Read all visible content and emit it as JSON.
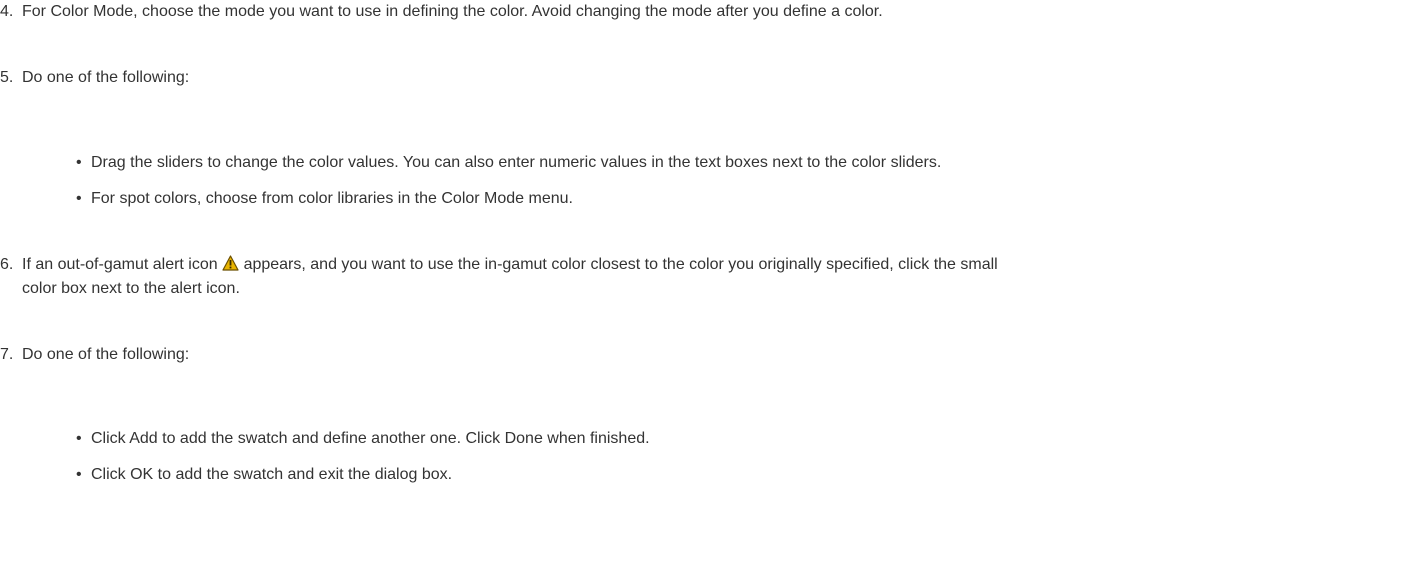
{
  "steps": [
    {
      "number": "4.",
      "text": "For Color Mode, choose the mode you want to use in defining the color. Avoid changing the mode after you define a color."
    },
    {
      "number": "5.",
      "text": "Do one of the following:",
      "bullets": [
        "Drag the sliders to change the color values. You can also enter numeric values in the text boxes next to the color sliders.",
        "For spot colors, choose from color libraries in the Color Mode menu."
      ]
    },
    {
      "number": "6.",
      "text_before_icon": "If an out-of-gamut alert icon",
      "text_after_icon": "appears, and you want to use the in-gamut color closest to the color you originally specified, click the small",
      "text_line2": "color box next to the alert icon.",
      "icon": "warning-triangle-icon"
    },
    {
      "number": "7.",
      "text": "Do one of the following:",
      "bullets": [
        "Click Add to add the swatch and define another one. Click Done when finished.",
        "Click OK to add the swatch and exit the dialog box."
      ]
    }
  ],
  "bullet_char": "•",
  "colors": {
    "text": "#333333",
    "icon_fill": "#e8b400",
    "icon_border": "#6b4f00"
  }
}
